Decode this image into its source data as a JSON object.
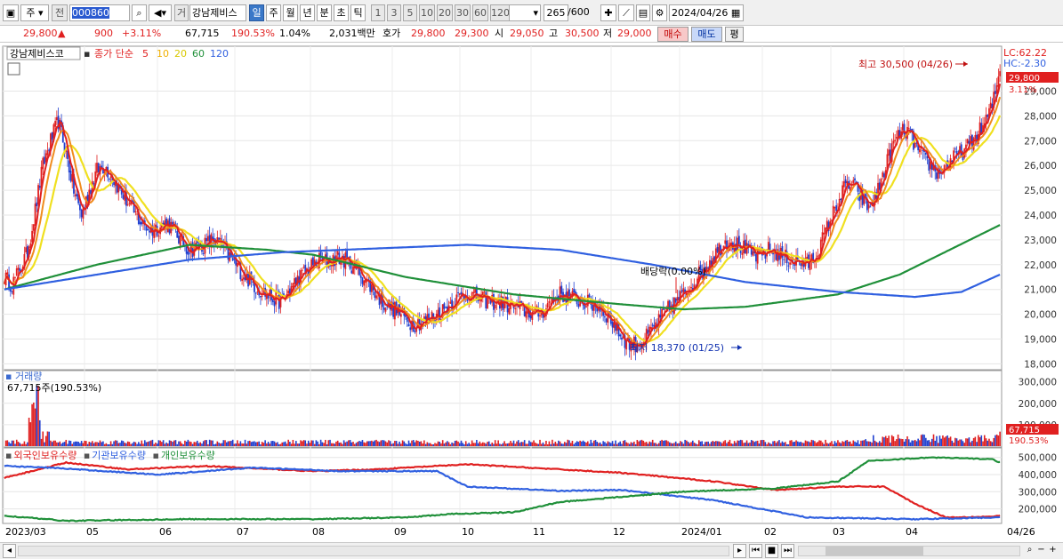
{
  "toolbar": {
    "market_label": "주",
    "prev_label": "전",
    "stock_code": "000860",
    "query_label": "거",
    "stock_name": "강남제비스",
    "periods": [
      "일",
      "주",
      "월",
      "년",
      "분",
      "초",
      "틱"
    ],
    "active_period": "일",
    "intervals": [
      "1",
      "3",
      "5",
      "10",
      "20",
      "30",
      "60",
      "120"
    ],
    "count": "265",
    "count_total": "/600",
    "date": "2024/04/26"
  },
  "infobar": {
    "price": "29,800",
    "change": "900",
    "change_pct": "+3.11%",
    "volume": "67,715",
    "volume_ratio": "190.53%",
    "turnover": "1.04%",
    "amount": "2,031백만",
    "quote_label": "호가",
    "ask": "29,800",
    "bid": "29,300",
    "open_label": "시",
    "open": "29,050",
    "high_label": "고",
    "high": "30,500",
    "low_label": "저",
    "low": "29,000",
    "buy_label": "매수",
    "sell_label": "매도",
    "eval_label": "평"
  },
  "colors": {
    "up": "#e02020",
    "down": "#2040d0",
    "ma5": "#e02020",
    "ma10": "#f08c1e",
    "ma20": "#f0e020",
    "ma60": "#20903a",
    "ma120": "#3060e0",
    "foreign": "#e02020",
    "institution": "#3060e0",
    "individual": "#20903a"
  },
  "price_panel": {
    "legend_name": "강남제비스코",
    "legend_ma": "종가 단순",
    "legend_periods": [
      "5",
      "10",
      "20",
      "60",
      "120"
    ],
    "lc_label": "LC:62.22",
    "hc_label": "HC:-2.30",
    "current_price": "29,800",
    "current_pct": "3.11%",
    "high_note": "최고 30,500 (04/26)",
    "low_note": "최저 18,370 (01/25)",
    "dividend_note": "배당락(0.00%)",
    "y_ticks": [
      "29,000",
      "28,000",
      "27,000",
      "26,000",
      "25,000",
      "24,000",
      "23,000",
      "22,000",
      "21,000",
      "20,000",
      "19,000",
      "18,000"
    ]
  },
  "volume_panel": {
    "title": "거래량",
    "value_label": "67,715주(190.53%)",
    "y_ticks": [
      "300,000",
      "200,000",
      "100,000"
    ],
    "current_volume": "67,715",
    "current_pct": "190.53%"
  },
  "holdings_panel": {
    "series_names": [
      "외국인보유수량",
      "기관보유수량",
      "개인보유수량"
    ],
    "y_ticks": [
      "500,000",
      "400,000",
      "300,000",
      "200,000"
    ]
  },
  "x_axis": {
    "labels": [
      "2023/03",
      "05",
      "06",
      "07",
      "08",
      "09",
      "10",
      "11",
      "12",
      "2024/01",
      "02",
      "03",
      "04"
    ],
    "last_label": "04/26"
  },
  "chart_data": {
    "type": "line",
    "x_range": [
      "2023/03",
      "2024/04/26"
    ],
    "ylim": [
      18000,
      30500
    ],
    "price_anchors": [
      [
        0,
        21500
      ],
      [
        5,
        21200
      ],
      [
        10,
        21800
      ],
      [
        15,
        22500
      ],
      [
        20,
        24200
      ],
      [
        25,
        26000
      ],
      [
        30,
        27000
      ],
      [
        35,
        27800
      ],
      [
        40,
        26500
      ],
      [
        45,
        25000
      ],
      [
        50,
        24000
      ],
      [
        55,
        25000
      ],
      [
        60,
        25800
      ],
      [
        65,
        26000
      ],
      [
        70,
        25500
      ],
      [
        75,
        25000
      ],
      [
        80,
        24500
      ],
      [
        85,
        24000
      ],
      [
        90,
        23600
      ],
      [
        95,
        23400
      ],
      [
        100,
        23500
      ],
      [
        105,
        23700
      ],
      [
        110,
        23400
      ],
      [
        115,
        22900
      ],
      [
        120,
        22600
      ],
      [
        125,
        22700
      ],
      [
        130,
        22800
      ],
      [
        135,
        23000
      ],
      [
        140,
        22800
      ],
      [
        145,
        22400
      ],
      [
        150,
        22000
      ],
      [
        155,
        21600
      ],
      [
        160,
        21300
      ],
      [
        165,
        21000
      ],
      [
        170,
        20800
      ],
      [
        175,
        20600
      ],
      [
        180,
        20500
      ],
      [
        185,
        21000
      ],
      [
        190,
        21400
      ],
      [
        195,
        21700
      ],
      [
        200,
        22000
      ],
      [
        205,
        22200
      ],
      [
        210,
        22100
      ],
      [
        215,
        22300
      ],
      [
        220,
        22200
      ],
      [
        225,
        22000
      ],
      [
        230,
        21700
      ],
      [
        235,
        21300
      ],
      [
        240,
        20900
      ],
      [
        245,
        20500
      ],
      [
        250,
        20300
      ],
      [
        255,
        20100
      ],
      [
        260,
        19800
      ],
      [
        265,
        19600
      ],
      [
        270,
        19700
      ],
      [
        275,
        19800
      ],
      [
        280,
        20000
      ],
      [
        285,
        20200
      ],
      [
        290,
        20500
      ],
      [
        295,
        20700
      ],
      [
        300,
        20800
      ],
      [
        305,
        20700
      ],
      [
        310,
        20600
      ],
      [
        315,
        20500
      ],
      [
        320,
        20500
      ],
      [
        325,
        20400
      ],
      [
        330,
        20300
      ],
      [
        335,
        20200
      ],
      [
        340,
        20100
      ],
      [
        345,
        20000
      ],
      [
        350,
        20200
      ],
      [
        355,
        20600
      ],
      [
        360,
        20800
      ],
      [
        365,
        20700
      ],
      [
        370,
        20600
      ],
      [
        375,
        20500
      ],
      [
        380,
        20400
      ],
      [
        385,
        20300
      ],
      [
        390,
        20000
      ],
      [
        395,
        19600
      ],
      [
        400,
        19100
      ],
      [
        405,
        18800
      ],
      [
        410,
        18800
      ],
      [
        415,
        19000
      ],
      [
        420,
        19400
      ],
      [
        425,
        19800
      ],
      [
        430,
        20200
      ],
      [
        435,
        20500
      ],
      [
        440,
        20800
      ],
      [
        445,
        21200
      ],
      [
        450,
        21600
      ],
      [
        455,
        22000
      ],
      [
        460,
        22400
      ],
      [
        465,
        22800
      ],
      [
        470,
        23000
      ],
      [
        475,
        22800
      ],
      [
        480,
        22600
      ],
      [
        485,
        22400
      ],
      [
        490,
        22300
      ],
      [
        495,
        22600
      ],
      [
        500,
        22500
      ],
      [
        505,
        22300
      ],
      [
        510,
        22200
      ],
      [
        515,
        22100
      ],
      [
        520,
        22000
      ],
      [
        525,
        22300
      ],
      [
        530,
        23000
      ],
      [
        535,
        23800
      ],
      [
        540,
        24500
      ],
      [
        545,
        25200
      ],
      [
        550,
        25200
      ],
      [
        555,
        24700
      ],
      [
        560,
        24300
      ],
      [
        565,
        24800
      ],
      [
        570,
        25800
      ],
      [
        575,
        26700
      ],
      [
        580,
        27300
      ],
      [
        585,
        27400
      ],
      [
        590,
        26800
      ],
      [
        595,
        26300
      ],
      [
        600,
        26000
      ],
      [
        605,
        25700
      ],
      [
        610,
        26000
      ],
      [
        615,
        26300
      ],
      [
        620,
        26500
      ],
      [
        625,
        26800
      ],
      [
        630,
        27200
      ],
      [
        635,
        27700
      ],
      [
        640,
        28400
      ],
      [
        645,
        29800
      ]
    ],
    "ma60_anchors": [
      [
        0,
        21000
      ],
      [
        60,
        22000
      ],
      [
        120,
        22800
      ],
      [
        170,
        22600
      ],
      [
        200,
        22400
      ],
      [
        260,
        21500
      ],
      [
        330,
        20800
      ],
      [
        400,
        20400
      ],
      [
        440,
        20200
      ],
      [
        480,
        20300
      ],
      [
        540,
        20800
      ],
      [
        580,
        21600
      ],
      [
        645,
        23600
      ]
    ],
    "ma120_anchors": [
      [
        0,
        21000
      ],
      [
        60,
        21600
      ],
      [
        120,
        22200
      ],
      [
        180,
        22500
      ],
      [
        260,
        22700
      ],
      [
        300,
        22800
      ],
      [
        360,
        22600
      ],
      [
        420,
        22000
      ],
      [
        480,
        21300
      ],
      [
        540,
        20900
      ],
      [
        590,
        20700
      ],
      [
        620,
        20900
      ],
      [
        645,
        21600
      ]
    ],
    "holdings": {
      "foreign": [
        [
          0,
          380000
        ],
        [
          40,
          470000
        ],
        [
          80,
          430000
        ],
        [
          130,
          450000
        ],
        [
          200,
          420000
        ],
        [
          240,
          430000
        ],
        [
          300,
          460000
        ],
        [
          360,
          430000
        ],
        [
          400,
          410000
        ],
        [
          460,
          360000
        ],
        [
          500,
          310000
        ],
        [
          540,
          330000
        ],
        [
          570,
          330000
        ],
        [
          590,
          230000
        ],
        [
          610,
          150000
        ],
        [
          640,
          155000
        ],
        [
          645,
          160000
        ]
      ],
      "institution": [
        [
          0,
          450000
        ],
        [
          30,
          440000
        ],
        [
          100,
          400000
        ],
        [
          160,
          440000
        ],
        [
          220,
          420000
        ],
        [
          280,
          420000
        ],
        [
          300,
          330000
        ],
        [
          360,
          305000
        ],
        [
          400,
          310000
        ],
        [
          420,
          290000
        ],
        [
          460,
          250000
        ],
        [
          520,
          150000
        ],
        [
          590,
          140000
        ],
        [
          645,
          150000
        ]
      ],
      "individual": [
        [
          0,
          160000
        ],
        [
          40,
          130000
        ],
        [
          120,
          140000
        ],
        [
          200,
          140000
        ],
        [
          260,
          150000
        ],
        [
          290,
          170000
        ],
        [
          330,
          180000
        ],
        [
          360,
          240000
        ],
        [
          400,
          270000
        ],
        [
          440,
          300000
        ],
        [
          500,
          320000
        ],
        [
          540,
          360000
        ],
        [
          560,
          480000
        ],
        [
          600,
          500000
        ],
        [
          640,
          490000
        ],
        [
          645,
          470000
        ]
      ]
    }
  }
}
